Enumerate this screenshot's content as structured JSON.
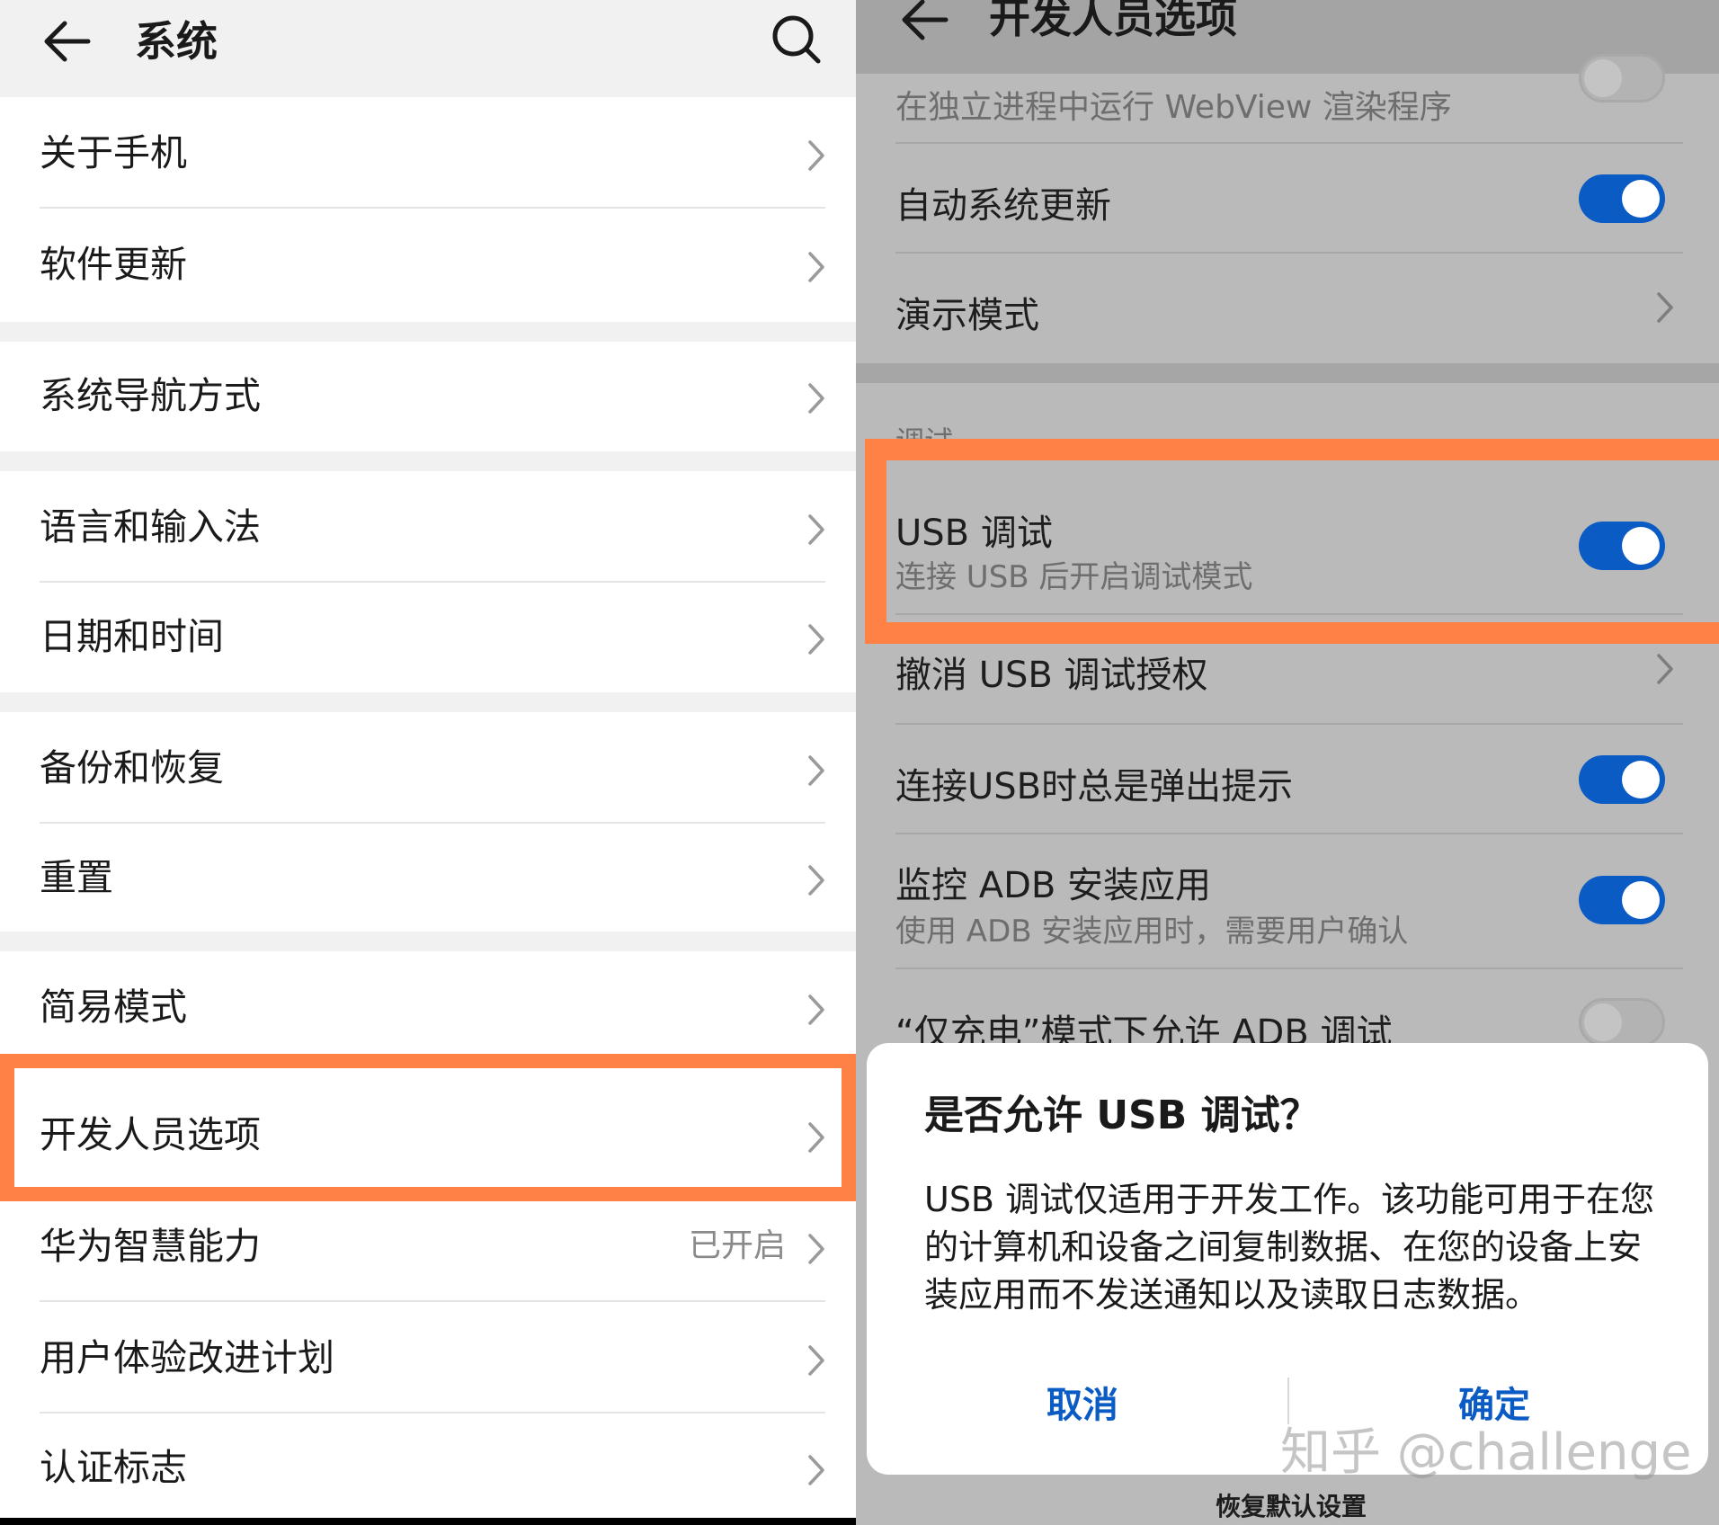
{
  "left": {
    "title": "系统",
    "items": [
      {
        "label": "关于手机"
      },
      {
        "label": "软件更新"
      },
      {
        "label": "系统导航方式"
      },
      {
        "label": "语言和输入法"
      },
      {
        "label": "日期和时间"
      },
      {
        "label": "备份和恢复"
      },
      {
        "label": "重置"
      },
      {
        "label": "简易模式"
      },
      {
        "label": "开发人员选项"
      },
      {
        "label": "华为智慧能力",
        "value": "已开启"
      },
      {
        "label": "用户体验改进计划"
      },
      {
        "label": "认证标志"
      }
    ]
  },
  "right": {
    "title": "开发人员选项",
    "webview": {
      "label": "在独立进程中运行 WebView 渲染程序"
    },
    "auto_update": {
      "label": "自动系统更新",
      "toggle": true
    },
    "demo": {
      "label": "演示模式"
    },
    "section_debug": "调试",
    "usb_debug": {
      "label": "USB 调试",
      "sub": "连接 USB 后开启调试模式",
      "toggle": true
    },
    "revoke": {
      "label": "撤消 USB 调试授权"
    },
    "usb_prompt": {
      "label": "连接USB时总是弹出提示",
      "toggle": true
    },
    "adb_monitor": {
      "label": "监控 ADB 安装应用",
      "sub": "使用 ADB 安装应用时，需要用户确认",
      "toggle": true
    },
    "charge_only": {
      "label": "“仅充电”模式下允许 ADB 调试",
      "toggle": false
    },
    "reset_defaults": "恢复默认设置"
  },
  "dialog": {
    "title": "是否允许 USB 调试？",
    "body": "USB 调试仅适用于开发工作。该功能可用于在您的计算机和设备之间复制数据、在您的设备上安装应用而不发送通知以及读取日志数据。",
    "cancel": "取消",
    "confirm": "确定"
  },
  "watermark": "知乎 @challenge",
  "colors": {
    "accent": "#0a5bc4",
    "highlight": "#ff8146"
  }
}
